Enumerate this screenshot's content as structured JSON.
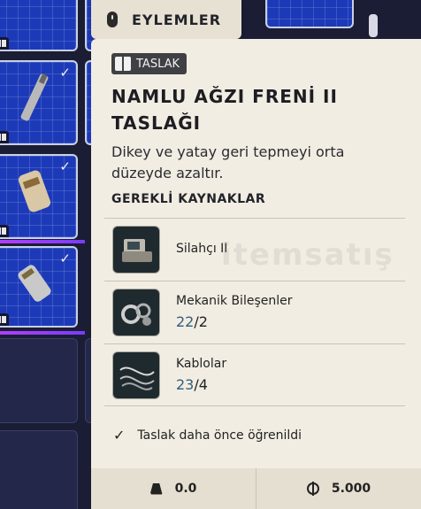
{
  "header": {
    "actions_label": "EYLEMLER",
    "mouse_icon": "mouse-icon"
  },
  "tooltip": {
    "badge": {
      "label": "TASLAK",
      "icon": "book-icon"
    },
    "title_line1": "NAMLU AĞZI FRENİ II",
    "title_line2": "TASLAĞI",
    "description": "Dikey ve yatay geri tepmeyi orta düzeyde azaltır.",
    "resources_title": "GEREKLİ KAYNAKLAR",
    "resources": [
      {
        "name": "Silahçı II",
        "have": "",
        "need": ""
      },
      {
        "name": "Mekanik Bileşenler",
        "have": "22",
        "need": "2"
      },
      {
        "name": "Kablolar",
        "have": "23",
        "need": "4"
      }
    ],
    "learned_text": "Taslak daha önce öğrenildi",
    "footer": {
      "weight": "0.0",
      "weight_icon": "weight-icon",
      "price": "5.000",
      "price_icon": "coin-icon"
    }
  },
  "watermark": "itemsatış",
  "colors": {
    "panel": "#f2ede3",
    "grid_blue": "#1c3ab8",
    "have_count": "#2f5e7a",
    "rarity_glow": "#b23dff"
  }
}
